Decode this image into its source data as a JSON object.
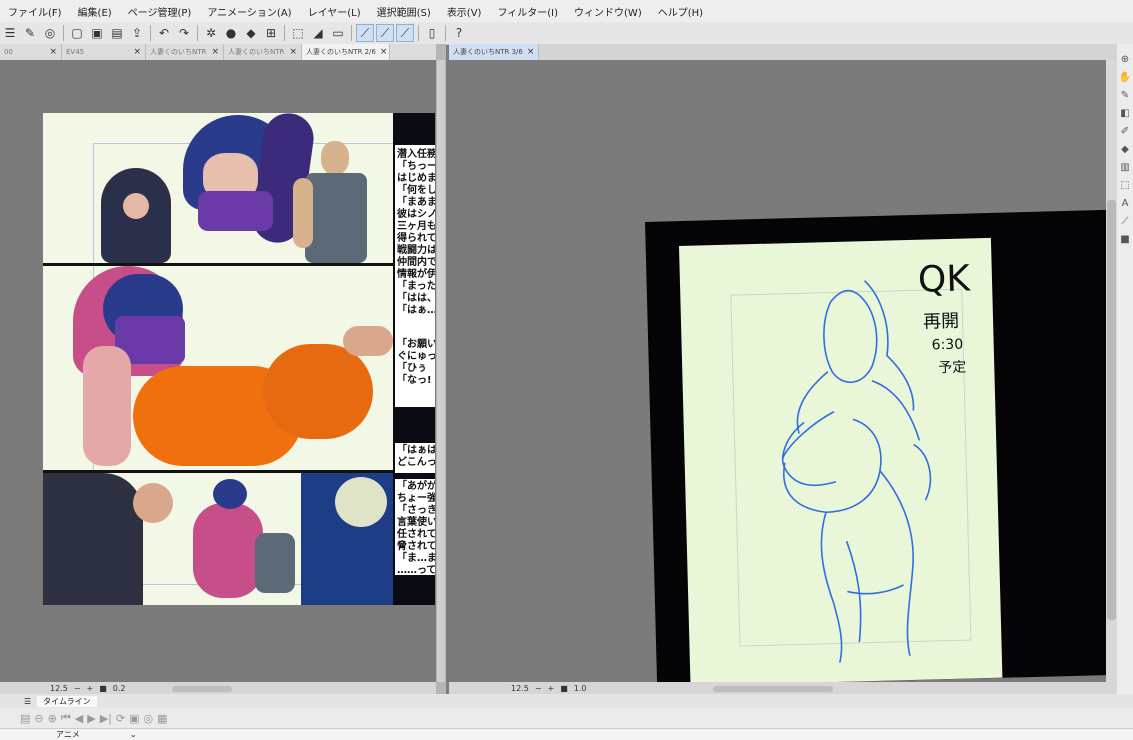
{
  "menu": [
    "ファイル(F)",
    "編集(E)",
    "ページ管理(P)",
    "アニメーション(A)",
    "レイヤー(L)",
    "選択範囲(S)",
    "表示(V)",
    "フィルター(I)",
    "ウィンドウ(W)",
    "ヘルプ(H)"
  ],
  "left_tabs": [
    {
      "label": "00",
      "active": false
    },
    {
      "label": "EV45",
      "active": false
    },
    {
      "label": "人妻くのいちNTR",
      "active": false
    },
    {
      "label": "人妻くのいちNTR",
      "active": false
    },
    {
      "label": "人妻くのいちNTR 2/6",
      "active": true
    }
  ],
  "right_tab": {
    "label": "人妻くのいちNTR 3/6"
  },
  "left_status": {
    "zoom": "12.5",
    "angle": "0.2"
  },
  "right_status": {
    "zoom": "12.5",
    "angle": "1.0"
  },
  "timeline": {
    "title": "タイムライン",
    "track": "アニメ"
  },
  "comic": {
    "side_lines": [
      "潜入任務",
      "「ちっー",
      "はじめま",
      "「何をし",
      "「まあま",
      "彼はシノ",
      "三ヶ月も",
      "得られて",
      "戦闘力は",
      "仲間内で",
      "情報が伊",
      "「まった",
      "「はは、",
      "「はぁ…"
    ],
    "mid_lines": [
      "「お願い",
      "ぐにゅっ",
      "「ひぅ",
      "「なっ!"
    ],
    "lower_lines": [
      "「はぁは",
      "どこんっ"
    ],
    "bottom_lines": [
      "「あがが",
      "ちょー強",
      "「さっき",
      "言葉使い",
      "任されて",
      "脅されて",
      "「ま…ま",
      "……って"
    ]
  },
  "sketch_note": {
    "title": "QK",
    "line1": "再開",
    "line2": "6:30",
    "line3": "予定"
  }
}
